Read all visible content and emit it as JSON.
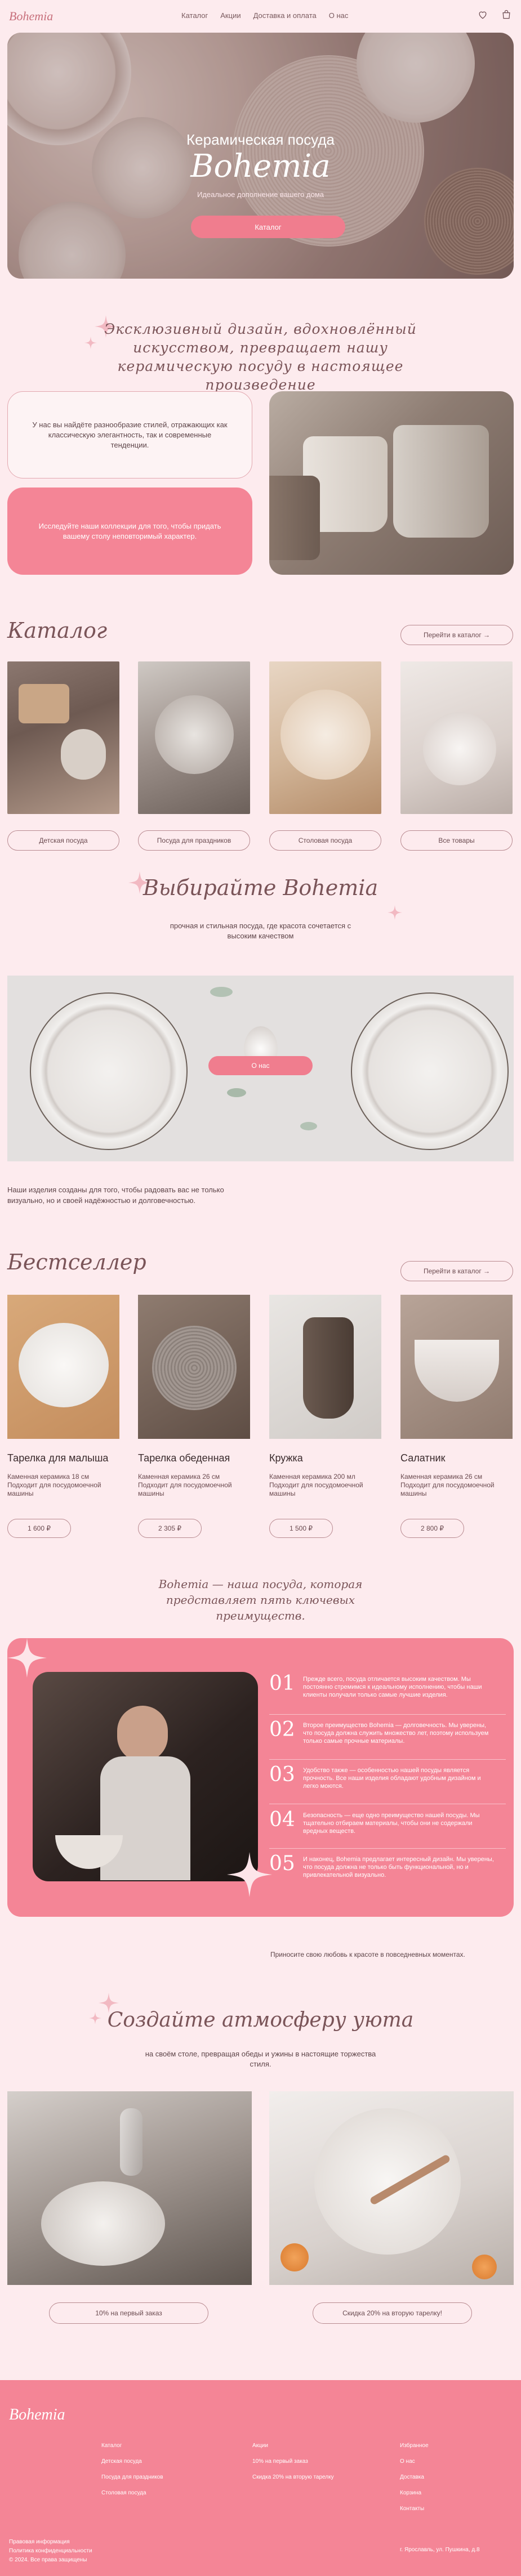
{
  "header": {
    "logo": "Bohemia",
    "nav": [
      "Каталог",
      "Акции",
      "Доставка и оплата",
      "О нас"
    ],
    "icons": [
      "heart-icon",
      "bag-icon"
    ]
  },
  "hero": {
    "title1": "Керамическая посуда",
    "title2": "Bohemia",
    "subtitle": "Идеальное дополнение вашего дома",
    "button": "Каталог"
  },
  "slogan": "Эксклюзивный дизайн, вдохновлённый искусством, превращает нашу керамическую посуду в настоящее произведение",
  "info": {
    "card1": "У нас вы найдёте разнообразие стилей, отражающих как классическую элегантность, так и современные тенденции.",
    "card2": "Исследуйте наши коллекции для того, чтобы придать вашему столу неповторимый характер."
  },
  "catalog": {
    "title": "Каталог",
    "link": "Перейти в каталог",
    "items": [
      "Детская посуда",
      "Посуда для праздников",
      "Столовая посуда",
      "Все товары"
    ]
  },
  "choose": {
    "title": "Выбирайте Bohemia",
    "subtitle": "прочная и стильная посуда, где красота сочетается с высоким качеством",
    "button": "О нас",
    "note": "Наши изделия созданы для того, чтобы радовать вас не только визуально, но и своей надёжностью и долговечностью."
  },
  "bestseller": {
    "title": "Бестселлер",
    "link": "Перейти в каталог",
    "products": [
      {
        "name": "Тарелка для малыша",
        "desc": "Каменная керамика 18 см Подходит для посудомоечной машины",
        "price": "1 600 ₽"
      },
      {
        "name": "Тарелка обеденная",
        "desc": "Каменная керамика 26 см Подходит для посудомоечной машины",
        "price": "2 305 ₽"
      },
      {
        "name": "Кружка",
        "desc": "Каменная керамика 200 мл Подходит для посудомоечной машины",
        "price": "1 500 ₽"
      },
      {
        "name": "Салатник",
        "desc": "Каменная керамика 26 см Подходит для посудомоечной машины",
        "price": "2 800 ₽"
      }
    ]
  },
  "five": {
    "title": "Bohemia — наша посуда, которая представляет пять ключевых преимуществ.",
    "items": [
      {
        "num": "01",
        "text": "Прежде всего, посуда отличается высоким качеством. Мы постоянно стремимся к идеальному исполнению, чтобы наши клиенты получали только самые лучшие изделия."
      },
      {
        "num": "02",
        "text": "Второе преимущество Bohemia — долговечность. Мы уверены, что посуда должна служить множество лет, поэтому используем только самые прочные материалы."
      },
      {
        "num": "03",
        "text": "Удобство также — особенностью нашей посуды является прочность. Все наши изделия обладают удобным дизайном и легко моются."
      },
      {
        "num": "04",
        "text": "Безопасность — еще одно преимущество нашей посуды. Мы тщательно отбираем материалы, чтобы они не содержали вредных веществ."
      },
      {
        "num": "05",
        "text": "И наконец, Bohemia предлагает интересный дизайн. Мы уверены, что посуда должна не только быть функциональной, но и привлекательной визуально."
      }
    ],
    "share": "Приносите свою любовь к красоте в повседневных моментах."
  },
  "cozy": {
    "title": "Создайте атмосферу уюта",
    "subtitle": "на своём столе, превращая обеды и ужины в настоящие торжества стиля.",
    "buttons": [
      "10% на первый заказ",
      "Скидка 20% на вторую тарелку!"
    ]
  },
  "footer": {
    "logo": "Bohemia",
    "col1": [
      "Каталог",
      "Детская посуда",
      "Посуда для праздников",
      "Столовая посуда"
    ],
    "col2": [
      "Акции",
      "10% на первый заказ",
      "Скидка 20% на вторую тарелку"
    ],
    "col3": [
      "Избранное",
      "О нас",
      "Доставка",
      "Корзина",
      "Контакты"
    ],
    "address": "г. Ярославль, ул. Пушкина, д.8",
    "bottom1": "Правовая информация",
    "bottom2": "Политика конфиденциальности",
    "bottom3": "© 2024. Все права защищены"
  }
}
